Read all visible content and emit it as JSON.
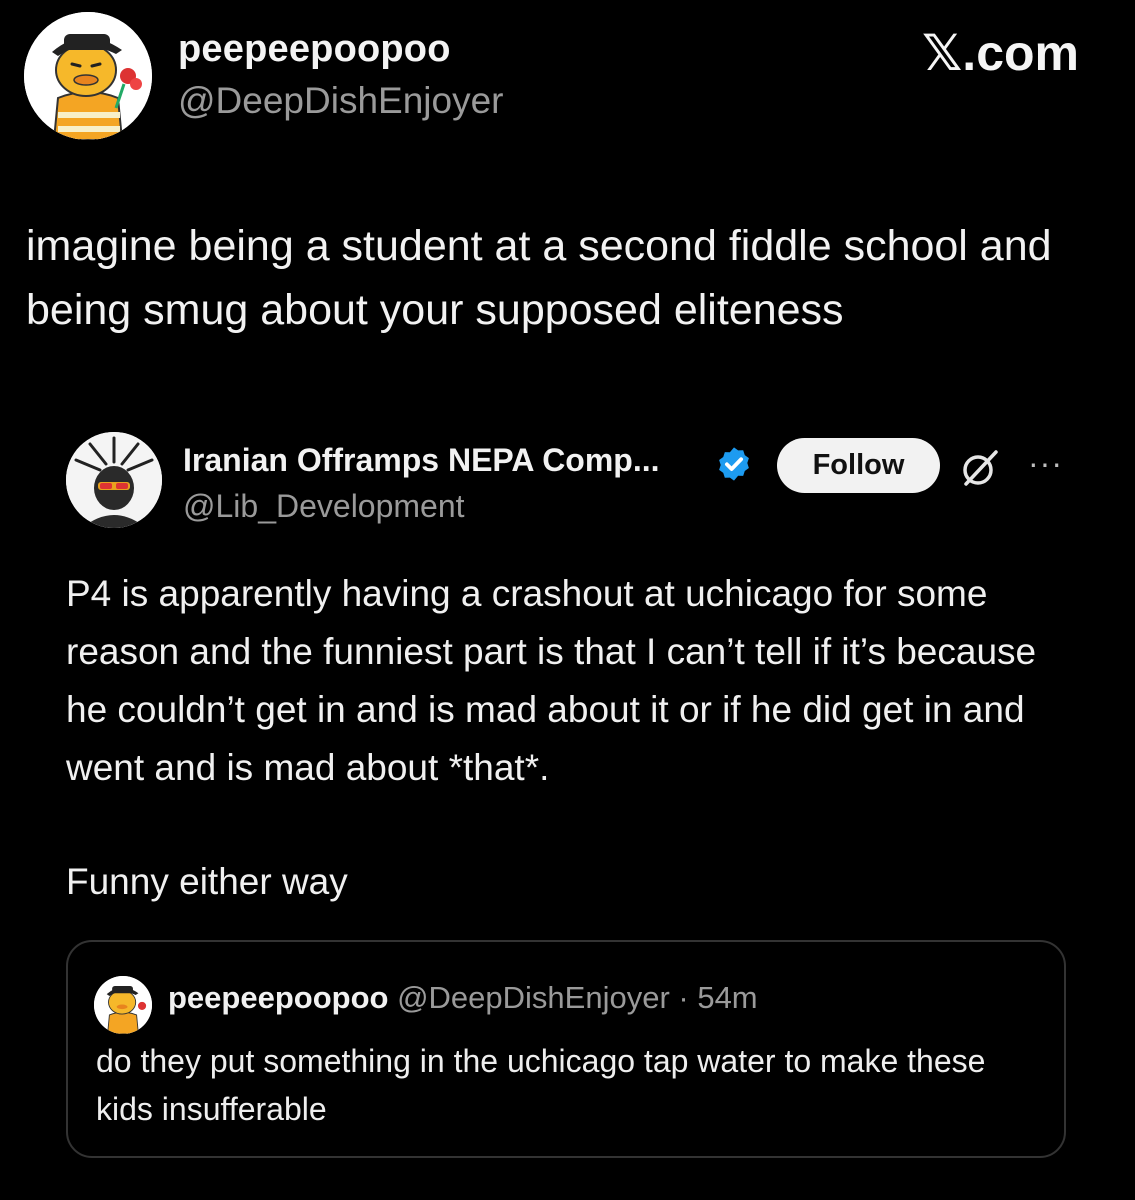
{
  "post": {
    "display_name": "peepeepoopoo",
    "handle": "@DeepDishEnjoyer",
    "text": "imagine being a student at a second fiddle school and being smug about your supposed eliteness"
  },
  "brand": {
    "label": "𝕏.com"
  },
  "quoted": {
    "display_name": "Iranian Offramps NEPA Comp...",
    "handle": "@Lib_Development",
    "follow_label": "Follow",
    "more_label": "···",
    "paragraph_1": "P4 is apparently having a crashout at uchicago for some reason and the funniest part is that I can’t tell if it’s because he couldn’t get in and is mad about it or if he did get in and went and is mad about *that*.",
    "paragraph_2": "Funny either way",
    "nested": {
      "display_name": "peepeepoopoo",
      "meta": "@DeepDishEnjoyer · 54m",
      "text": "do they put something in the uchicago tap water to make these kids insufferable"
    }
  },
  "colors": {
    "background": "#000000",
    "verified_blue": "#1d9bf0",
    "secondary_text": "#9a9a9a"
  },
  "icons": {
    "verified": "verified-badge-icon",
    "grok": "grok-icon",
    "more": "more-icon"
  }
}
